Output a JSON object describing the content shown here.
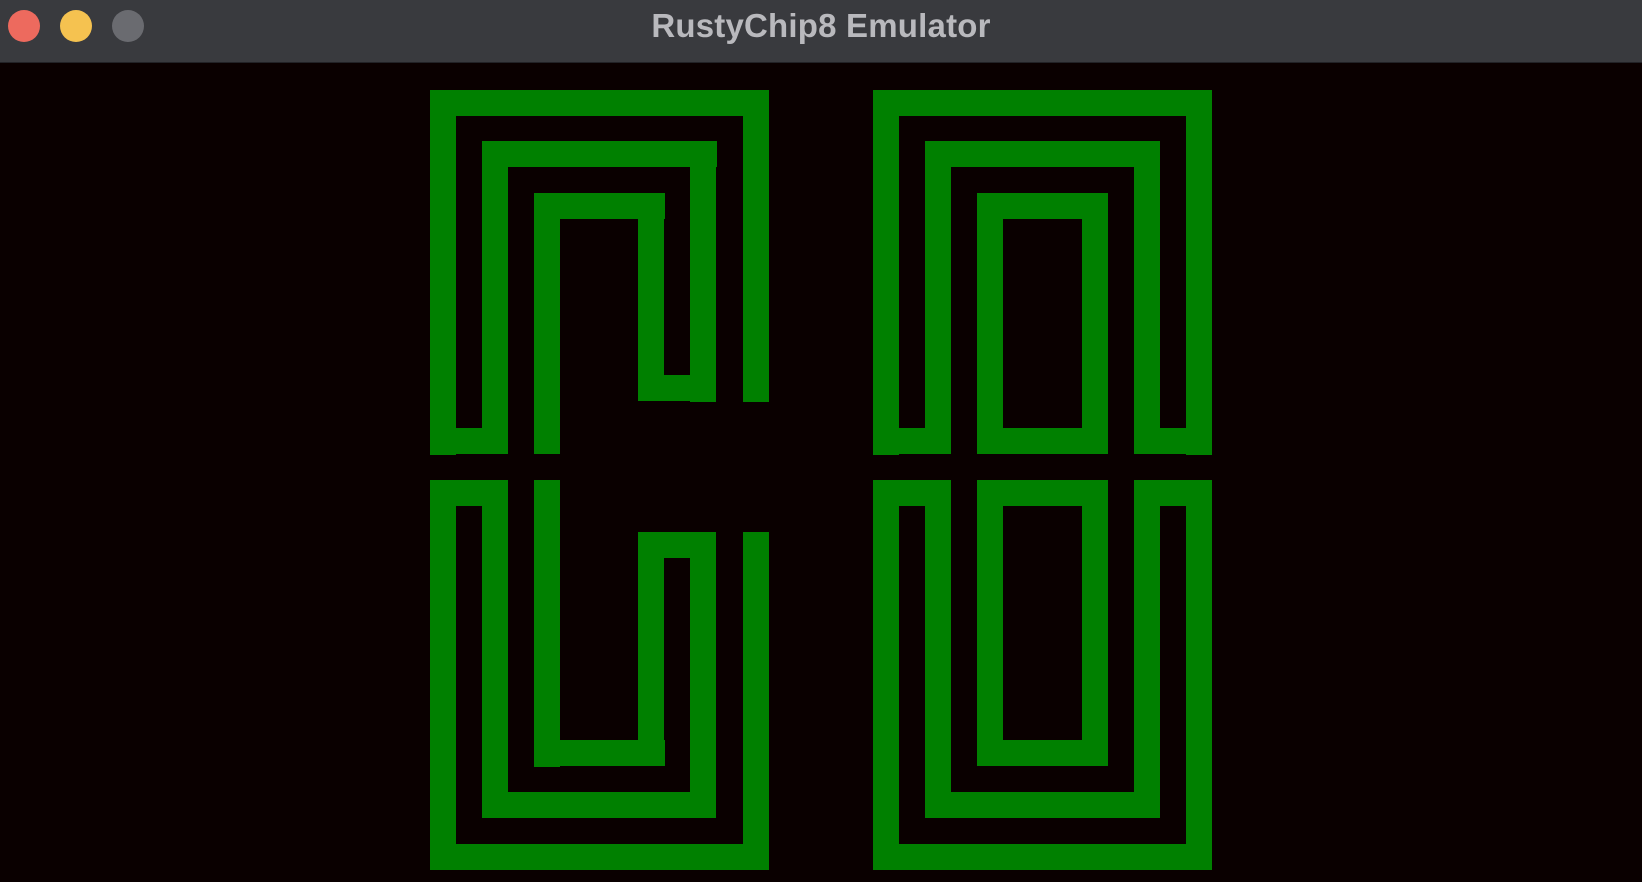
{
  "window": {
    "title": "RustyChip8 Emulator",
    "buttons": {
      "close_color": "#ed6a5e",
      "minimize_color": "#f5c250",
      "zoom_color": "#6a6b70"
    }
  },
  "display": {
    "background_color": "#0a0000",
    "pixel_color": "#008000"
  }
}
